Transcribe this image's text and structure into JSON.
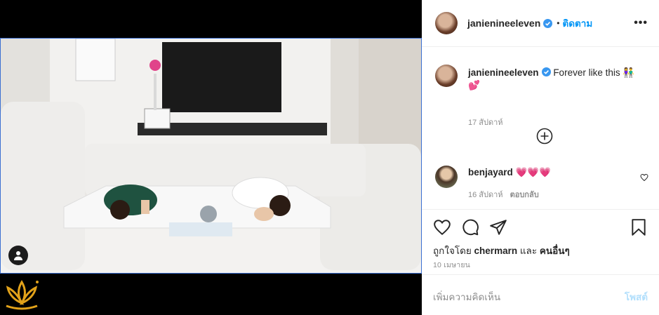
{
  "post": {
    "username": "janienineeleven",
    "follow_label": "ติดตาม",
    "dot": "•",
    "more": "•••",
    "caption_text": "Forever like this 👫💕",
    "caption_time": "17 สัปดาห์"
  },
  "comment": {
    "username": "benjayard",
    "text": "💗💗💗",
    "time": "16 สัปดาห์",
    "reply_label": "ตอบกลับ"
  },
  "likes": {
    "prefix": "ถูกใจโดย",
    "user": "chermarn",
    "middle": "และ",
    "others": "คนอื่นๆ"
  },
  "post_date": "10 เมษายน",
  "add_comment": {
    "placeholder": "เพิ่มความคิดเห็น",
    "post_label": "โพสต์"
  },
  "colors": {
    "accent": "#0095f6",
    "verified": "#3897f0",
    "muted": "#8e8e8e"
  },
  "icons": [
    "user-tag-icon",
    "verified-icon",
    "more-icon",
    "add-circle-icon",
    "heart-icon",
    "comment-icon",
    "share-icon",
    "bookmark-icon",
    "logo-icon"
  ]
}
